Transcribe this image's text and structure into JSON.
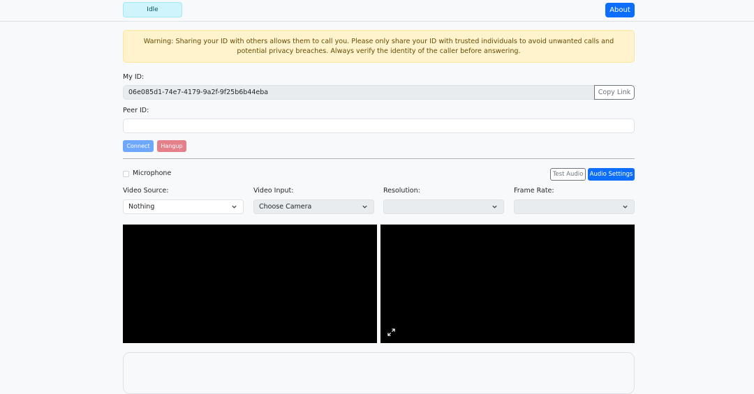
{
  "header": {
    "status": "Idle",
    "about_label": "About"
  },
  "warning": {
    "text": "Warning: Sharing your ID with others allows them to call you. Please only share your ID with trusted individuals to avoid unwanted calls and potential privacy breaches. Always verify the identity of the caller before answering."
  },
  "my_id": {
    "label": "My ID:",
    "value": "06e085d1-74e7-4179-9a2f-9f25b6b44eba",
    "copy_label": "Copy Link"
  },
  "peer_id": {
    "label": "Peer ID:",
    "value": ""
  },
  "call": {
    "connect_label": "Connect",
    "hangup_label": "Hangup"
  },
  "audio": {
    "microphone_label": "Microphone",
    "microphone_checked": false,
    "test_label": "Test Audio",
    "settings_label": "Audio Settings"
  },
  "video": {
    "source_label": "Video Source:",
    "source_value": "Nothing",
    "input_label": "Video Input:",
    "input_value": "Choose Camera",
    "resolution_label": "Resolution:",
    "resolution_value": "",
    "framerate_label": "Frame Rate:",
    "framerate_value": ""
  },
  "colors": {
    "primary": "#0d6efd",
    "warning_bg": "#fff3cd",
    "info_bg": "#cff4fc"
  },
  "icons": [
    "chevron-down-icon",
    "expand-icon"
  ]
}
